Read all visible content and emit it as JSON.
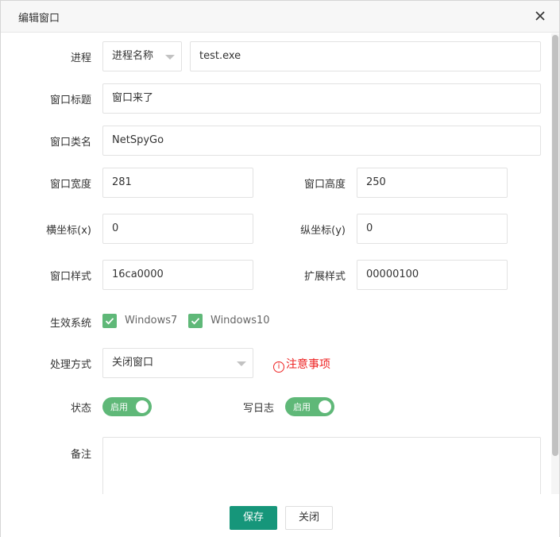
{
  "dialog": {
    "title": "编辑窗口"
  },
  "form": {
    "process": {
      "label": "进程",
      "type_value": "进程名称",
      "name_value": "test.exe"
    },
    "window_title": {
      "label": "窗口标题",
      "value": "窗口来了"
    },
    "window_class": {
      "label": "窗口类名",
      "value": "NetSpyGo"
    },
    "window_width": {
      "label": "窗口宽度",
      "value": "281"
    },
    "window_height": {
      "label": "窗口高度",
      "value": "250"
    },
    "x_coord": {
      "label": "横坐标(x)",
      "value": "0"
    },
    "y_coord": {
      "label": "纵坐标(y)",
      "value": "0"
    },
    "window_style": {
      "label": "窗口样式",
      "value": "16ca0000"
    },
    "ext_style": {
      "label": "扩展样式",
      "value": "00000100"
    },
    "systems": {
      "label": "生效系统",
      "options": [
        {
          "label": "Windows7",
          "checked": true
        },
        {
          "label": "Windows10",
          "checked": true
        }
      ]
    },
    "handling": {
      "label": "处理方式",
      "value": "关闭窗口",
      "notice": "注意事项",
      "notice_icon": "i"
    },
    "status": {
      "label": "状态",
      "switch_text": "启用",
      "on": true
    },
    "write_log": {
      "label": "写日志",
      "switch_text": "启用",
      "on": true
    },
    "remark": {
      "label": "备注",
      "value": ""
    }
  },
  "footer": {
    "save_label": "保存",
    "close_label": "关闭"
  },
  "colors": {
    "accent": "#16967a",
    "checkbox": "#5fb878",
    "switch": "#5fb878",
    "notice": "#ee2222"
  }
}
